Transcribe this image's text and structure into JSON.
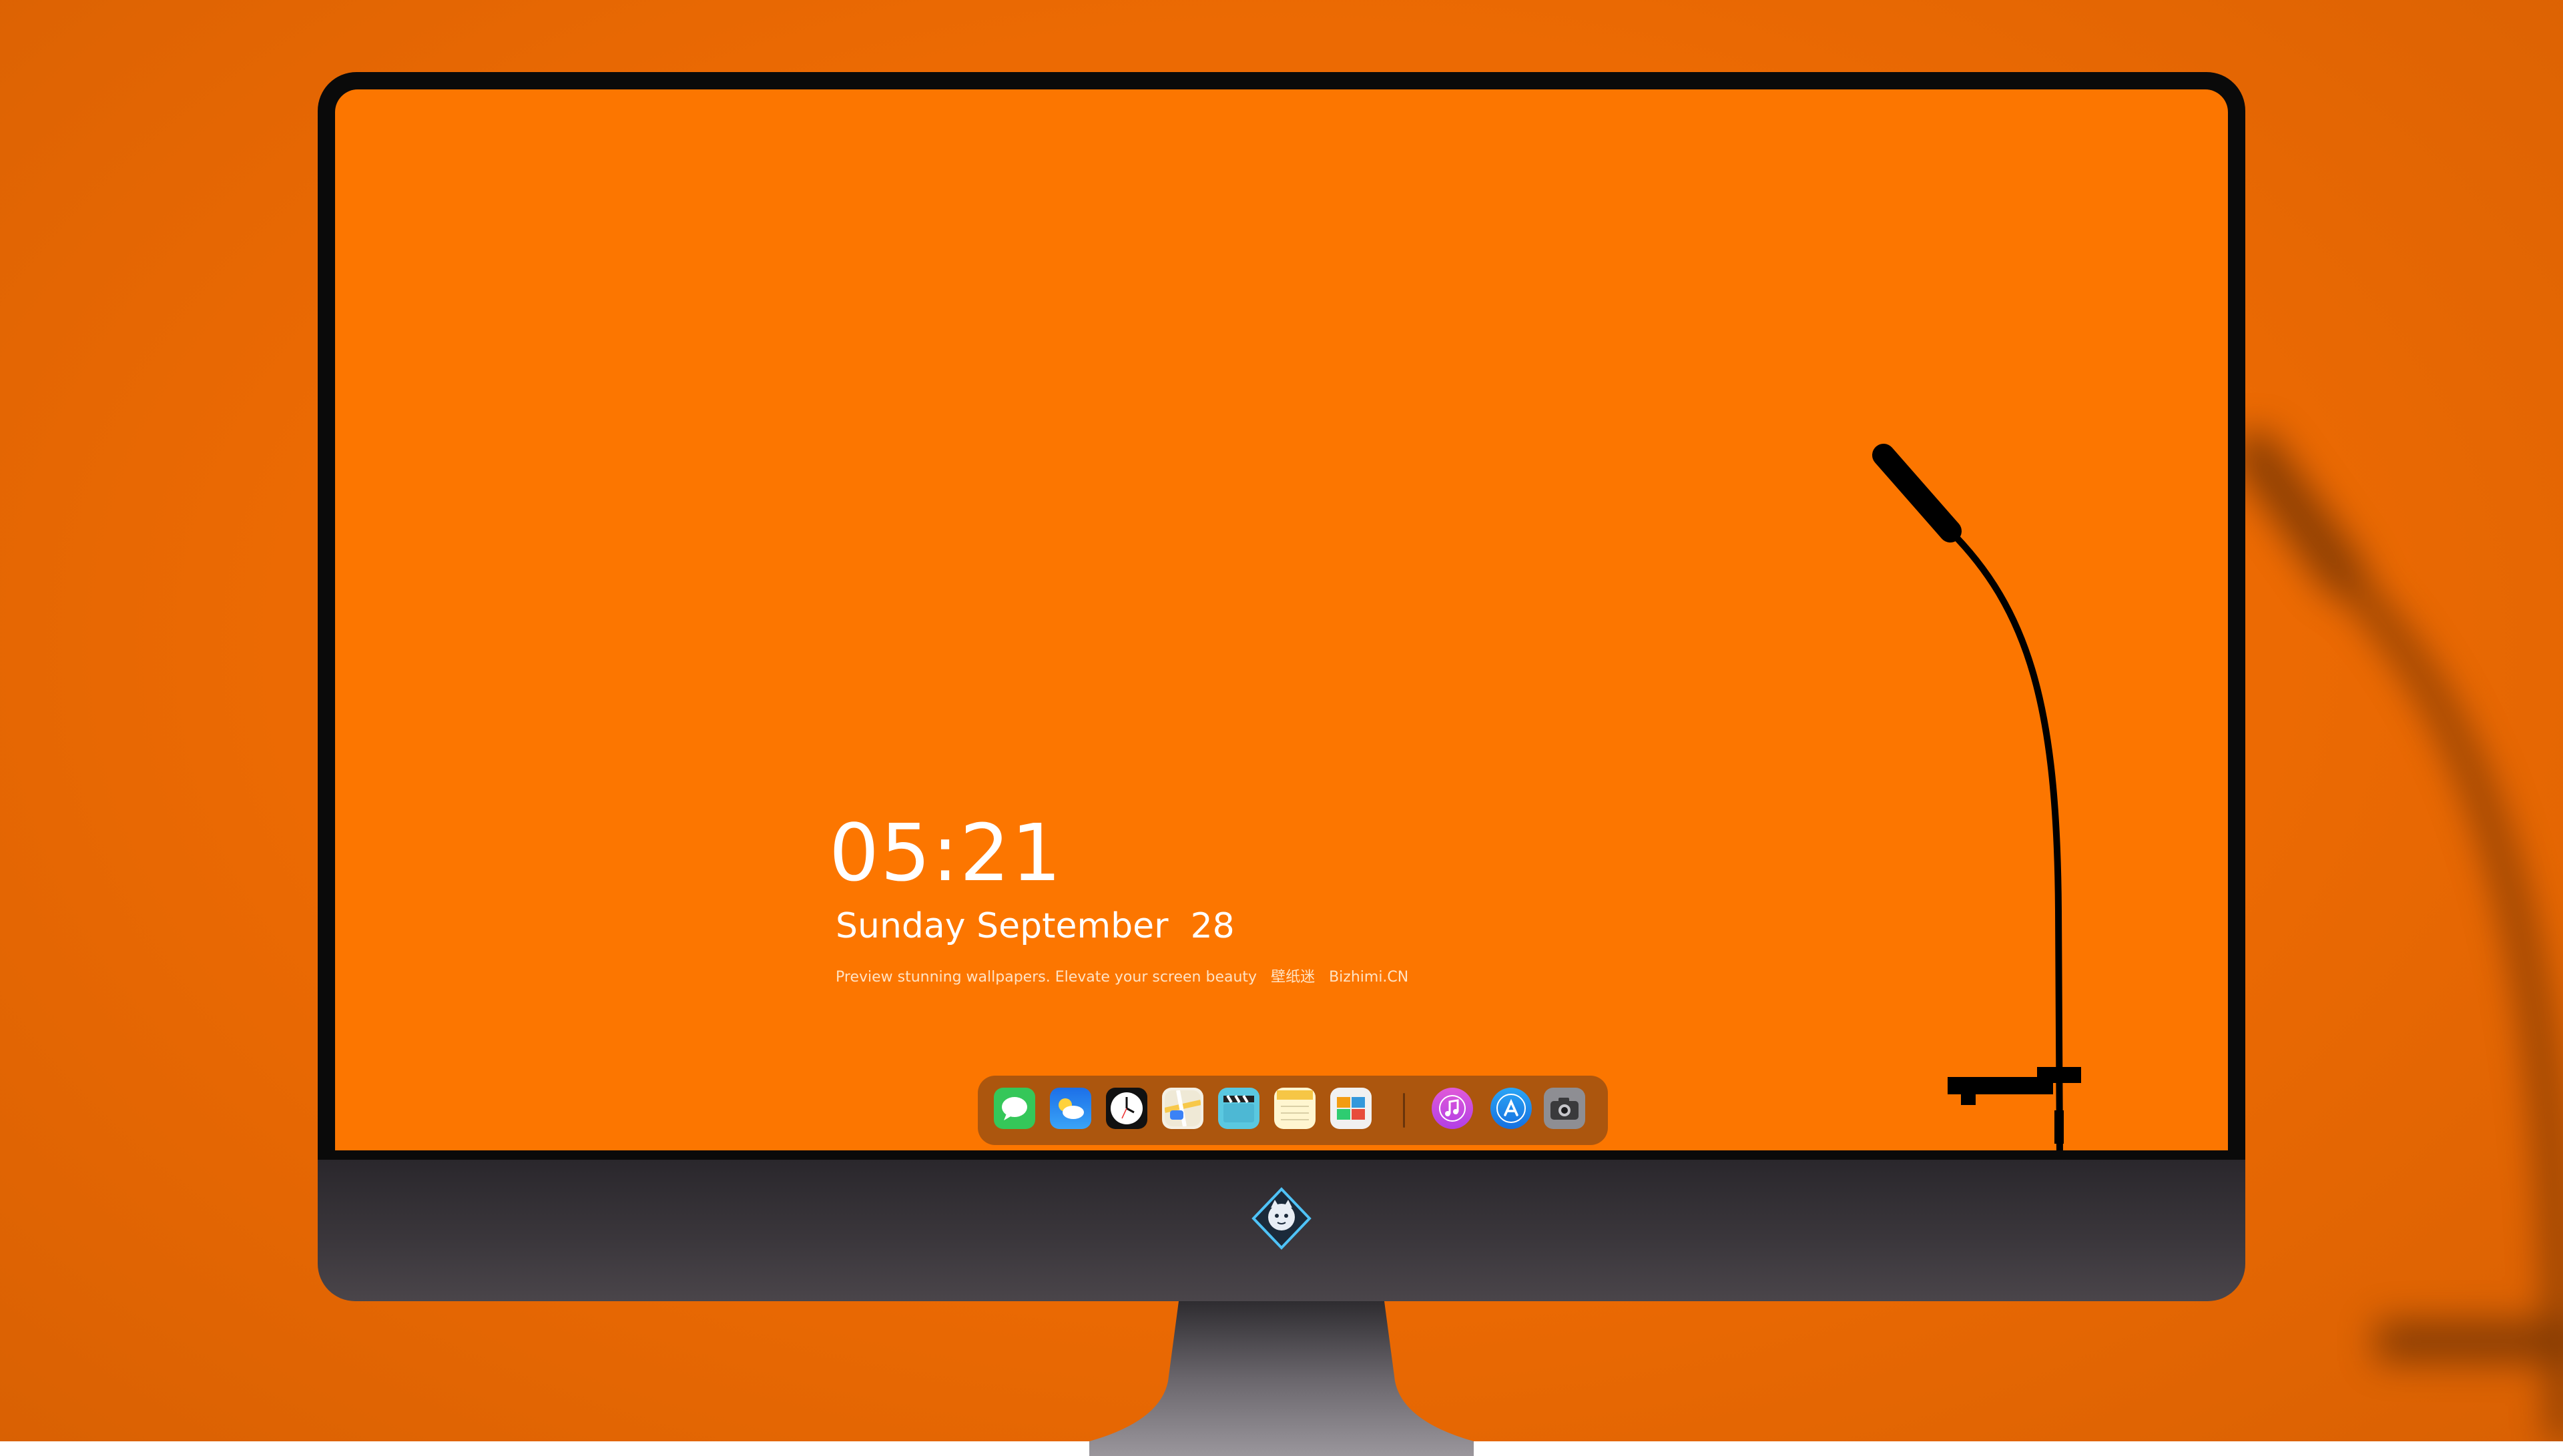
{
  "desktop": {
    "clock_time": "05:21",
    "date_weekday_month": "Sunday September",
    "date_day": "28",
    "tagline_preview": "Preview stunning wallpapers. Elevate your screen beauty",
    "tagline_brand_cn": "壁纸迷",
    "tagline_site": "Bizhimi.CN"
  },
  "dock": {
    "items": [
      {
        "name": "messages",
        "icon": "speech-bubble-icon",
        "color": "#35c759"
      },
      {
        "name": "weather",
        "icon": "sun-cloud-icon",
        "color": "#1e8ef5"
      },
      {
        "name": "clock",
        "icon": "clock-icon",
        "color": "#111111"
      },
      {
        "name": "maps",
        "icon": "map-icon",
        "color": "#f4f0e4"
      },
      {
        "name": "video",
        "icon": "clapperboard-icon",
        "color": "#5ac8e0"
      },
      {
        "name": "notes",
        "icon": "notes-icon",
        "color": "#fff6d0"
      },
      {
        "name": "photos",
        "icon": "photos-icon",
        "color": "#f1f1f1"
      },
      {
        "name": "music",
        "icon": "music-note-icon",
        "color": "#c94ee3"
      },
      {
        "name": "app-store",
        "icon": "app-store-icon",
        "color": "#1a8df0"
      },
      {
        "name": "camera",
        "icon": "camera-icon",
        "color": "#8e8e93"
      }
    ]
  },
  "colors": {
    "wallpaper": "#fc7600",
    "backdrop": "#ec6a03",
    "bezel": "#0a0a0a",
    "chin": "#3a363b"
  }
}
